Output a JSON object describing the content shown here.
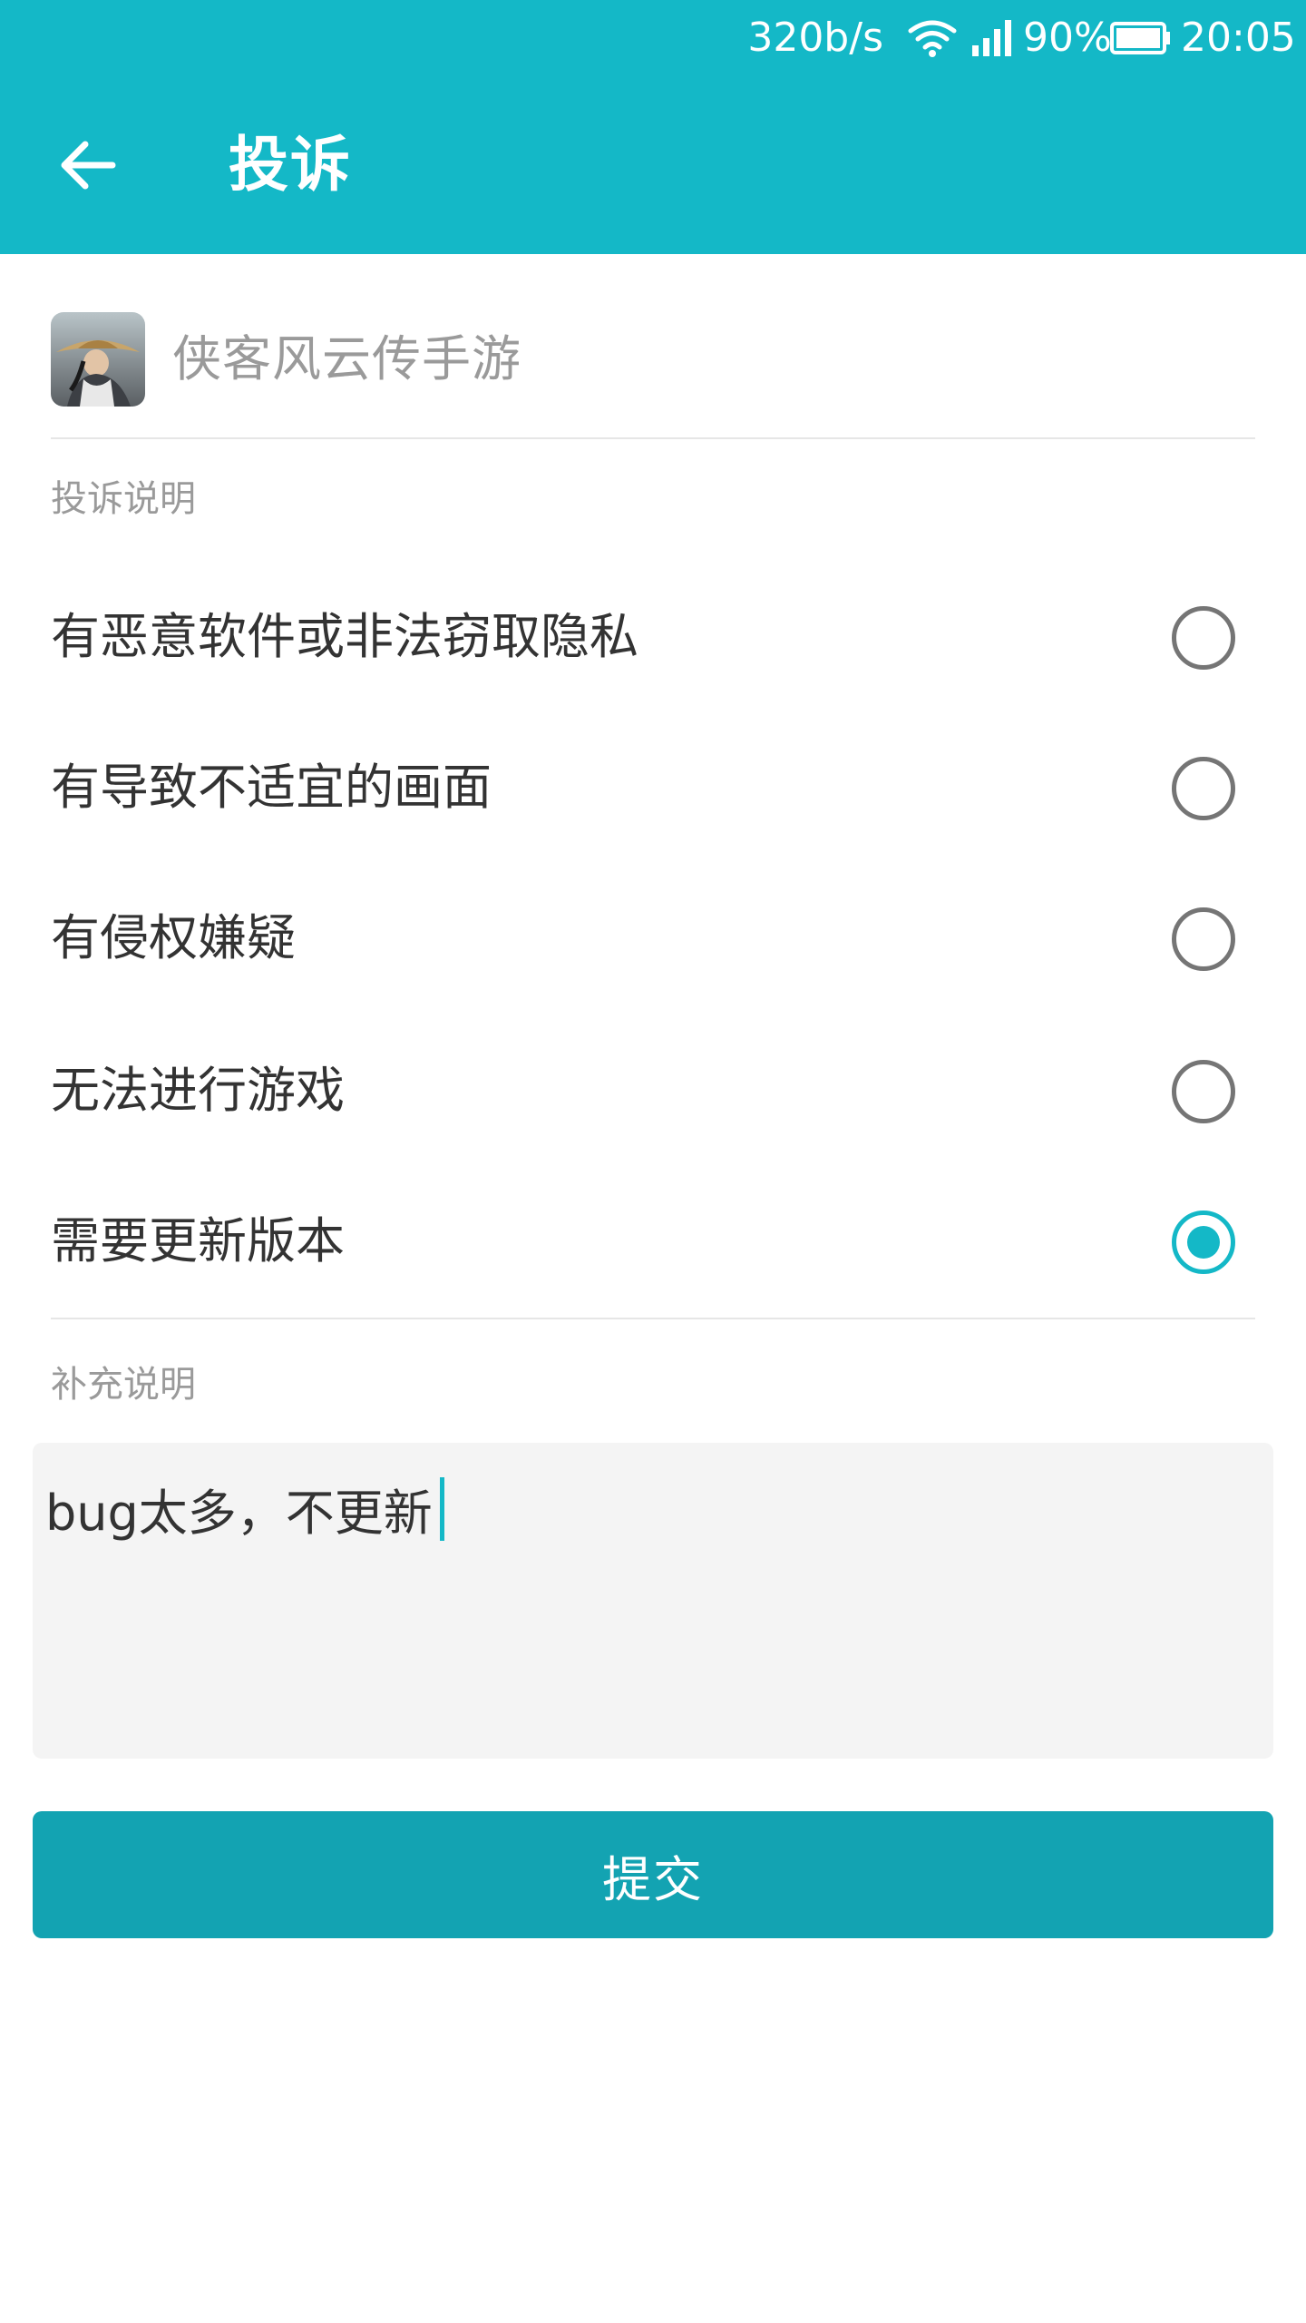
{
  "status_bar": {
    "net_speed": "320b/s",
    "wifi_icon": "wifi-icon",
    "signal_icon": "cell-signal-icon",
    "battery_percent": "90%",
    "battery_icon": "battery-icon",
    "time": "20:05"
  },
  "app_bar": {
    "back_icon": "arrow-left-icon",
    "title": "投诉"
  },
  "app": {
    "name": "侠客风云传手游",
    "icon": "game-app-icon"
  },
  "complaint": {
    "label": "投诉说明",
    "options": [
      {
        "label": "有恶意软件或非法窃取隐私",
        "checked": false
      },
      {
        "label": "有导致不适宜的画面",
        "checked": false
      },
      {
        "label": "有侵权嫌疑",
        "checked": false
      },
      {
        "label": "无法进行游戏",
        "checked": false
      },
      {
        "label": "需要更新版本",
        "checked": true
      }
    ]
  },
  "extra": {
    "label": "补充说明",
    "value": "bug太多，不更新"
  },
  "submit": {
    "label": "提交"
  },
  "colors": {
    "accent": "#14b8c7",
    "button": "#13a3b2",
    "text_primary": "#333333",
    "text_secondary": "#9a9a9a",
    "input_background": "#f4f4f4"
  }
}
